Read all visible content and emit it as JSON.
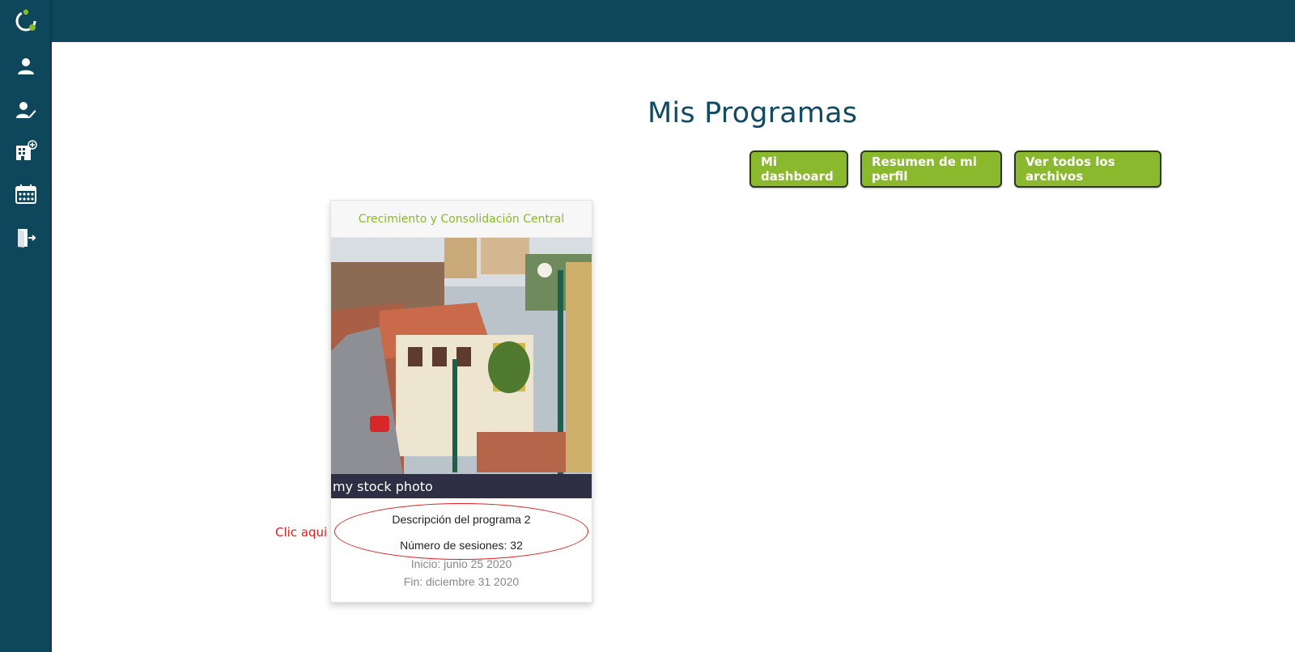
{
  "app": {
    "colors": {
      "primary": "#0e475c",
      "accent": "#8ab92d",
      "annotation": "#e02020"
    }
  },
  "sidebar": {
    "items": [
      {
        "icon": "user-icon"
      },
      {
        "icon": "user-edit-icon"
      },
      {
        "icon": "building-add-icon"
      },
      {
        "icon": "calendar-icon"
      },
      {
        "icon": "logout-icon"
      }
    ]
  },
  "main": {
    "title": "Mis Programas",
    "buttons": {
      "dashboard": "Mi dashboard",
      "profile_summary": "Resumen de mi perfil",
      "all_files": "Ver todos los archivos"
    }
  },
  "program_card": {
    "name": "Crecimiento y Consolidación Central",
    "image_caption": "my stock photo",
    "description": "Descripción del programa 2",
    "sessions": "Número de sesiones: 32",
    "start": "Inicio: junio 25 2020",
    "end": "Fin: diciembre 31 2020"
  },
  "annotation": {
    "label": "Clic aqui"
  }
}
